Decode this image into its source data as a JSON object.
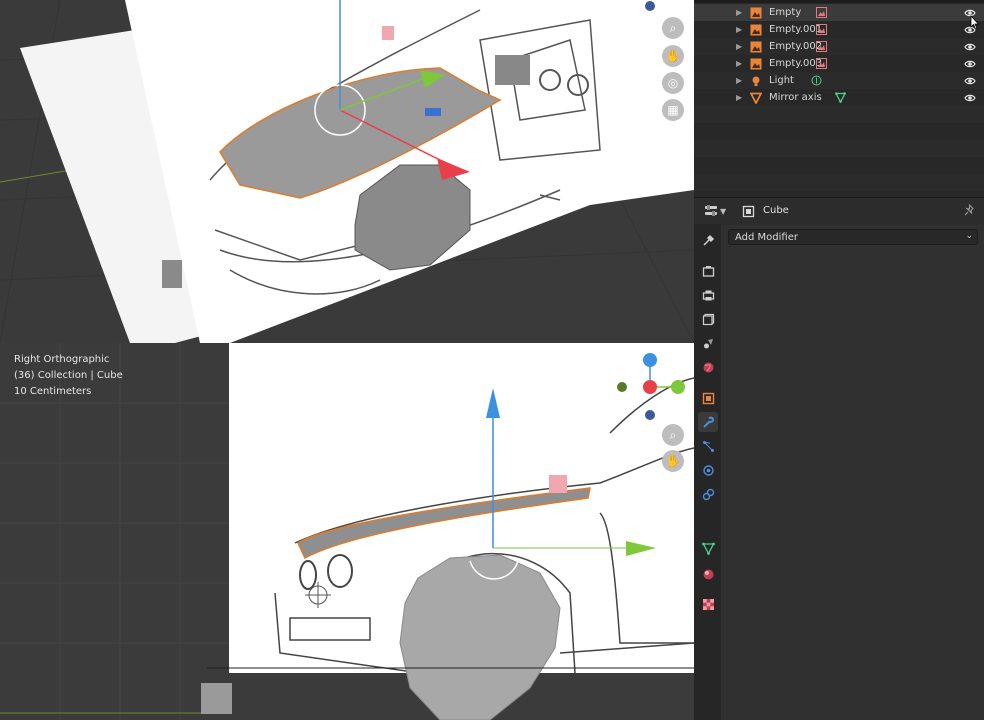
{
  "viewport_bottom": {
    "view_name": "Right Orthographic",
    "collection_path": "(36) Collection | Cube",
    "scale": "10 Centimeters"
  },
  "outliner": {
    "items": [
      {
        "label": "Empty",
        "type": "empty",
        "selected": true
      },
      {
        "label": "Empty.001",
        "type": "empty"
      },
      {
        "label": "Empty.002",
        "type": "empty"
      },
      {
        "label": "Empty.003",
        "type": "empty"
      },
      {
        "label": "Light",
        "type": "light"
      },
      {
        "label": "Mirror axis",
        "type": "mesh"
      }
    ]
  },
  "properties": {
    "object_name": "Cube",
    "add_modifier_label": "Add Modifier",
    "active_tab": "modifiers-tab"
  },
  "colors": {
    "selection_outline": "#e07b28",
    "axis_x": "#e8404a",
    "axis_y": "#7ec83a",
    "axis_z": "#3d8fe0",
    "object_orange": "#e8853a",
    "data_green": "#4fcf8a"
  }
}
